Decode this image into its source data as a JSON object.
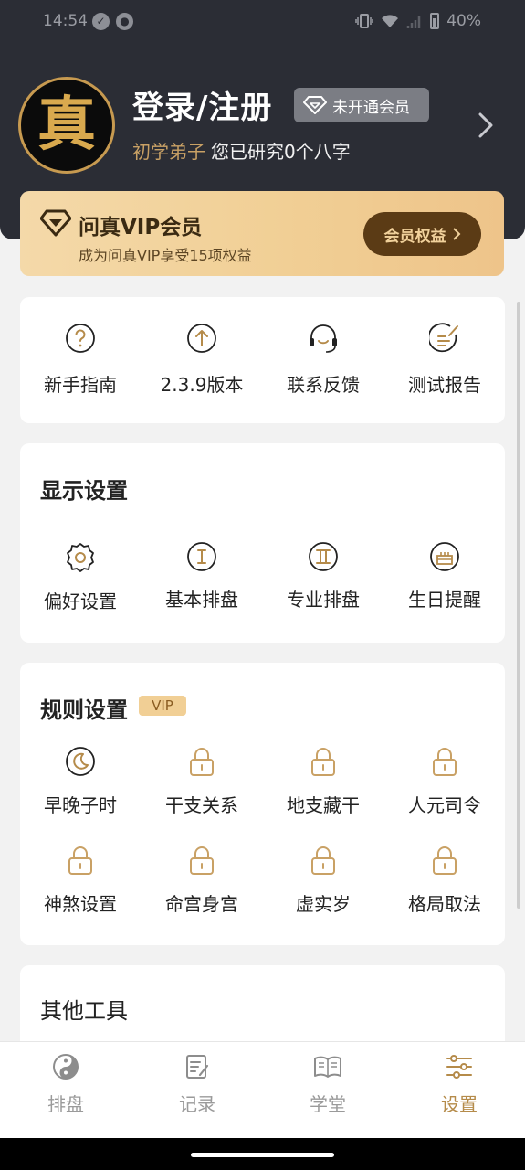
{
  "status_bar": {
    "time": "14:54",
    "battery": "40%"
  },
  "profile": {
    "avatar_glyph": "真",
    "login_title": "登录/注册",
    "member_badge": "未开通会员",
    "rank": "初学弟子",
    "study_text": "您已研究0个八字"
  },
  "vip_card": {
    "title": "问真VIP会员",
    "subtitle": "成为问真VIP享受15项权益",
    "button": "会员权益"
  },
  "quick_menu": [
    {
      "label": "新手指南",
      "icon": "question-circle-icon"
    },
    {
      "label": "2.3.9版本",
      "icon": "arrow-up-circle-icon"
    },
    {
      "label": "联系反馈",
      "icon": "headset-icon"
    },
    {
      "label": "测试报告",
      "icon": "report-edit-icon"
    }
  ],
  "display_settings": {
    "title": "显示设置",
    "items": [
      {
        "label": "偏好设置",
        "icon": "gear-icon"
      },
      {
        "label": "基本排盘",
        "icon": "roman-one-icon"
      },
      {
        "label": "专业排盘",
        "icon": "roman-two-icon"
      },
      {
        "label": "生日提醒",
        "icon": "cake-icon"
      }
    ]
  },
  "rule_settings": {
    "title": "规则设置",
    "tag": "VIP",
    "items": [
      {
        "label": "早晚子时",
        "icon": "moon-icon"
      },
      {
        "label": "干支关系",
        "icon": "lock-icon"
      },
      {
        "label": "地支藏干",
        "icon": "lock-icon"
      },
      {
        "label": "人元司令",
        "icon": "lock-icon"
      },
      {
        "label": "神煞设置",
        "icon": "lock-icon"
      },
      {
        "label": "命宫身宫",
        "icon": "lock-icon"
      },
      {
        "label": "虚实岁",
        "icon": "lock-icon"
      },
      {
        "label": "格局取法",
        "icon": "lock-icon"
      }
    ]
  },
  "other_tools": {
    "title": "其他工具"
  },
  "tabbar": [
    {
      "label": "排盘",
      "icon": "yin-yang-icon",
      "active": false
    },
    {
      "label": "记录",
      "icon": "note-edit-icon",
      "active": false
    },
    {
      "label": "学堂",
      "icon": "book-icon",
      "active": false
    },
    {
      "label": "设置",
      "icon": "sliders-icon",
      "active": true
    }
  ],
  "colors": {
    "header_bg": "#2b2d35",
    "accent_gold": "#b58b4a",
    "vip_gold": "#f1cf95",
    "vip_button": "#5b3b15"
  }
}
